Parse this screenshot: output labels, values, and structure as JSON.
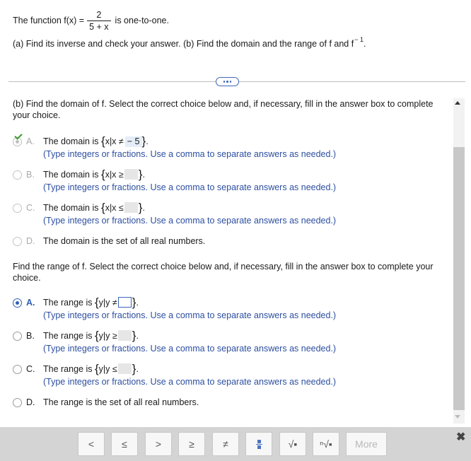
{
  "problem": {
    "prefix": "The function f(x) =",
    "numerator": "2",
    "denominator": "5 + x",
    "suffix": "is one-to-one.",
    "part_text": "(a) Find its inverse and check your answer. (b) Find the domain and the range of f and f",
    "inverse_exp": "− 1",
    "period": "."
  },
  "domain_question": "(b) Find the domain of f. Select the correct choice below and, if necessary, fill in the answer box to complete your choice.",
  "domain_choices": [
    {
      "letter": "A.",
      "text": "The domain is",
      "set": "x|x ≠",
      "value": "− 5",
      "hint": "(Type integers or fractions. Use a comma to separate answers as needed.)"
    },
    {
      "letter": "B.",
      "text": "The domain is",
      "set": "x|x ≥",
      "hint": "(Type integers or fractions. Use a comma to separate answers as needed.)"
    },
    {
      "letter": "C.",
      "text": "The domain is",
      "set": "x|x ≤",
      "hint": "(Type integers or fractions. Use a comma to separate answers as needed.)"
    },
    {
      "letter": "D.",
      "text": "The domain is the set of all real numbers."
    }
  ],
  "range_question": "Find the range of f. Select the correct choice below and, if necessary, fill in the answer box to complete your choice.",
  "range_choices": [
    {
      "letter": "A.",
      "text": "The range is",
      "set": "y|y ≠",
      "hint": "(Type integers or fractions. Use a comma to separate answers as needed.)"
    },
    {
      "letter": "B.",
      "text": "The range is",
      "set": "y|y ≥",
      "hint": "(Type integers or fractions. Use a comma to separate answers as needed.)"
    },
    {
      "letter": "C.",
      "text": "The range is",
      "set": "y|y ≤",
      "hint": "(Type integers or fractions. Use a comma to separate answers as needed.)"
    },
    {
      "letter": "D.",
      "text": "The range is the set of all real numbers."
    }
  ],
  "toolbar": {
    "lt": "<",
    "le": "≤",
    "gt": ">",
    "ge": "≥",
    "ne": "≠",
    "sqrt": "√▪",
    "nroot": "ⁿ√▪",
    "more": "More"
  },
  "brace_open": "{",
  "brace_close": "}",
  "dot": ".",
  "colors": {
    "accent": "#2f5fb3",
    "check": "#3a9a2c",
    "hint": "#2c4fa0"
  }
}
